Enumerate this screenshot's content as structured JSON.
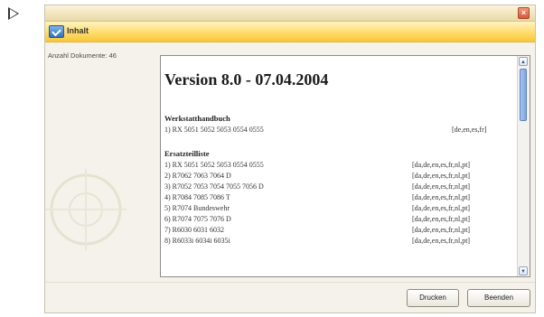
{
  "header": {
    "title": "Inhalt"
  },
  "left": {
    "doc_count": "Anzahl Dokumente: 46"
  },
  "content": {
    "version_title": "Version 8.0 - 07.04.2004",
    "sections": [
      {
        "title": "Werkstatthandbuch",
        "rows": [
          {
            "name": "1) RX 5051 5052 5053 0554 0555",
            "langs": "[de,en,es,fr]"
          }
        ]
      },
      {
        "title": "Ersatzteilliste",
        "rows": [
          {
            "name": "1) RX 5051 5052 5053 0554 0555",
            "langs": "[da,de,en,es,fr,nl,pt]"
          },
          {
            "name": "2) R7062 7063 7064 D",
            "langs": "[da,de,en,es,fr,nl,pt]"
          },
          {
            "name": "3) R7052 7053 7054 7055 7056 D",
            "langs": "[da,de,en,es,fr,nl,pt]"
          },
          {
            "name": "4) R7084 7085 7086 T",
            "langs": "[da,de,en,es,fr,nl,pt]"
          },
          {
            "name": "5) R7074 Bundeswehr",
            "langs": "[da,de,en,es,fr,nl,pt]"
          },
          {
            "name": "6) R7074 7075 7076 D",
            "langs": "[da,de,en,es,fr,nl,pt]"
          },
          {
            "name": "7) R6030 6031 6032",
            "langs": "[da,de,en,es,fr,nl,pt]"
          },
          {
            "name": "8) R6033i 6034i 6035i",
            "langs": "[da,de,en,es,fr,nl,pt]"
          }
        ]
      }
    ]
  },
  "buttons": {
    "print": "Drucken",
    "exit": "Beenden"
  },
  "icons": {
    "play": "play-icon",
    "close": "close-icon",
    "header": "checkmark-folder-icon",
    "scroll_up": "scroll-up-arrow-icon",
    "scroll_down": "scroll-down-arrow-icon"
  },
  "colors": {
    "header_bar": "#ffdc6a",
    "window_bg": "#f4f2ea",
    "scroll_thumb": "#7ea6e0",
    "close_button": "#d55a3a"
  }
}
